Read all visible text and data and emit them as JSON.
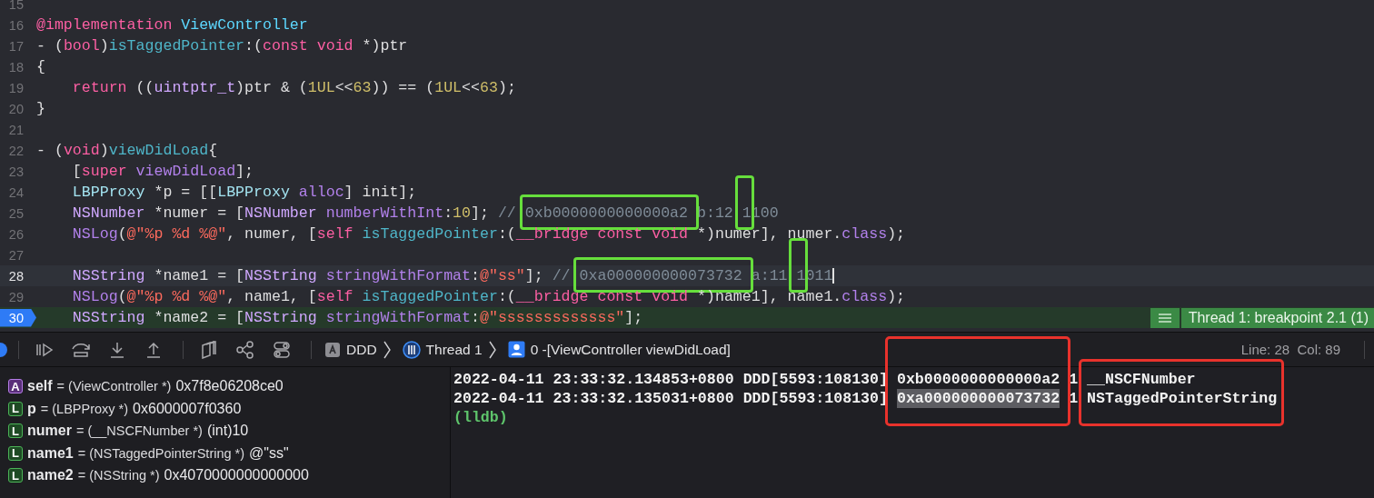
{
  "editor": {
    "lines": [
      {
        "number": "15",
        "current": false,
        "stopped": false
      },
      {
        "number": "16",
        "current": false,
        "stopped": false,
        "tokens": [
          {
            "kind": "keyword",
            "text": "@implementation"
          },
          {
            "kind": "project-class",
            "text": " ViewController"
          }
        ]
      },
      {
        "number": "17",
        "current": false,
        "stopped": false,
        "tokens": [
          {
            "kind": "plain",
            "text": "- ("
          },
          {
            "kind": "keyword",
            "text": "bool"
          },
          {
            "kind": "plain",
            "text": ")"
          },
          {
            "kind": "project-method",
            "text": "isTaggedPointer"
          },
          {
            "kind": "plain",
            "text": ":("
          },
          {
            "kind": "keyword",
            "text": "const"
          },
          {
            "kind": "keyword",
            "text": " void"
          },
          {
            "kind": "plain",
            "text": " *)ptr"
          }
        ]
      },
      {
        "number": "18",
        "current": false,
        "stopped": false,
        "tokens": [
          {
            "kind": "plain",
            "text": "{"
          }
        ]
      },
      {
        "number": "19",
        "current": false,
        "stopped": false,
        "tokens": [
          {
            "kind": "keyword",
            "text": "    return"
          },
          {
            "kind": "plain",
            "text": " (("
          },
          {
            "kind": "system-type",
            "text": "uintptr_t"
          },
          {
            "kind": "plain",
            "text": ")ptr & ("
          },
          {
            "kind": "number",
            "text": "1UL"
          },
          {
            "kind": "plain",
            "text": "<<"
          },
          {
            "kind": "number",
            "text": "63"
          },
          {
            "kind": "plain",
            "text": ")) == ("
          },
          {
            "kind": "number",
            "text": "1UL"
          },
          {
            "kind": "plain",
            "text": "<<"
          },
          {
            "kind": "number",
            "text": "63"
          },
          {
            "kind": "plain",
            "text": ");"
          }
        ]
      },
      {
        "number": "20",
        "current": false,
        "stopped": false,
        "tokens": [
          {
            "kind": "plain",
            "text": "}"
          }
        ]
      },
      {
        "number": "21",
        "current": false,
        "stopped": false
      },
      {
        "number": "22",
        "current": false,
        "stopped": false,
        "tokens": [
          {
            "kind": "plain",
            "text": "- ("
          },
          {
            "kind": "keyword",
            "text": "void"
          },
          {
            "kind": "plain",
            "text": ")"
          },
          {
            "kind": "project-method",
            "text": "viewDidLoad"
          },
          {
            "kind": "plain",
            "text": "{"
          }
        ]
      },
      {
        "number": "23",
        "current": false,
        "stopped": false,
        "tokens": [
          {
            "kind": "plain",
            "text": "    ["
          },
          {
            "kind": "keyword",
            "text": "super"
          },
          {
            "kind": "system-method",
            "text": " viewDidLoad"
          },
          {
            "kind": "plain",
            "text": "];"
          }
        ]
      },
      {
        "number": "24",
        "current": false,
        "stopped": false,
        "tokens": [
          {
            "kind": "project-type",
            "text": "    LBPProxy"
          },
          {
            "kind": "plain",
            "text": " *p = [["
          },
          {
            "kind": "project-type",
            "text": "LBPProxy"
          },
          {
            "kind": "system-method",
            "text": " alloc"
          },
          {
            "kind": "plain",
            "text": "] init];"
          }
        ]
      },
      {
        "number": "25",
        "current": false,
        "stopped": false,
        "tokens": [
          {
            "kind": "system-type",
            "text": "    NSNumber"
          },
          {
            "kind": "plain",
            "text": " *numer = ["
          },
          {
            "kind": "system-type",
            "text": "NSNumber"
          },
          {
            "kind": "system-method",
            "text": " numberWithInt"
          },
          {
            "kind": "plain",
            "text": ":"
          },
          {
            "kind": "number",
            "text": "10"
          },
          {
            "kind": "plain",
            "text": "]; "
          },
          {
            "kind": "comment",
            "text": "// "
          },
          {
            "kind": "comment",
            "text": "0xb0000000000000a2",
            "framed": true
          },
          {
            "kind": "comment",
            "text": " b:12 "
          },
          {
            "kind": "comment",
            "text": "1",
            "framed": true
          },
          {
            "kind": "comment",
            "text": "100"
          }
        ]
      },
      {
        "number": "26",
        "current": false,
        "stopped": false,
        "tokens": [
          {
            "kind": "system-method",
            "text": "    NSLog"
          },
          {
            "kind": "plain",
            "text": "("
          },
          {
            "kind": "string",
            "text": "@\"%p %d %@\""
          },
          {
            "kind": "plain",
            "text": ", numer, ["
          },
          {
            "kind": "keyword",
            "text": "self"
          },
          {
            "kind": "project-method",
            "text": " isTaggedPointer"
          },
          {
            "kind": "plain",
            "text": ":("
          },
          {
            "kind": "keyword",
            "text": "__bridge"
          },
          {
            "kind": "keyword",
            "text": " const"
          },
          {
            "kind": "keyword",
            "text": " void"
          },
          {
            "kind": "plain",
            "text": " *)numer], numer."
          },
          {
            "kind": "system-method",
            "text": "class"
          },
          {
            "kind": "plain",
            "text": ");"
          }
        ]
      },
      {
        "number": "27",
        "current": false,
        "stopped": false
      },
      {
        "number": "28",
        "current": true,
        "stopped": false,
        "tokens": [
          {
            "kind": "system-type",
            "text": "    NSString"
          },
          {
            "kind": "plain",
            "text": " *name1 = ["
          },
          {
            "kind": "system-type",
            "text": "NSString"
          },
          {
            "kind": "system-method",
            "text": " stringWithFormat"
          },
          {
            "kind": "plain",
            "text": ":"
          },
          {
            "kind": "string",
            "text": "@\"ss\""
          },
          {
            "kind": "plain",
            "text": "]; "
          },
          {
            "kind": "comment",
            "text": "// "
          },
          {
            "kind": "comment",
            "text": "0xa000000000073732",
            "framed": true
          },
          {
            "kind": "comment",
            "text": " a:11 "
          },
          {
            "kind": "comment",
            "text": "1",
            "framed": true
          },
          {
            "kind": "comment",
            "text": "011"
          }
        ]
      },
      {
        "number": "29",
        "current": false,
        "stopped": false,
        "tokens": [
          {
            "kind": "system-method",
            "text": "    NSLog"
          },
          {
            "kind": "plain",
            "text": "("
          },
          {
            "kind": "string",
            "text": "@\"%p %d %@\""
          },
          {
            "kind": "plain",
            "text": ", name1, ["
          },
          {
            "kind": "keyword",
            "text": "self"
          },
          {
            "kind": "project-method",
            "text": " isTaggedPointer"
          },
          {
            "kind": "plain",
            "text": ":("
          },
          {
            "kind": "keyword",
            "text": "__bridge"
          },
          {
            "kind": "keyword",
            "text": " const"
          },
          {
            "kind": "keyword",
            "text": " void"
          },
          {
            "kind": "plain",
            "text": " *)name1], name1."
          },
          {
            "kind": "system-method",
            "text": "class"
          },
          {
            "kind": "plain",
            "text": ");"
          }
        ]
      },
      {
        "number": "30",
        "current": false,
        "stopped": true,
        "tokens": [
          {
            "kind": "system-type",
            "text": "    NSString"
          },
          {
            "kind": "plain",
            "text": " *name2 = ["
          },
          {
            "kind": "system-type",
            "text": "NSString"
          },
          {
            "kind": "system-method",
            "text": " stringWithFormat"
          },
          {
            "kind": "plain",
            "text": ":"
          },
          {
            "kind": "string",
            "text": "@\"sssssssssssss\""
          },
          {
            "kind": "plain",
            "text": "];"
          }
        ],
        "annotation": "Thread 1: breakpoint 2.1 (1)"
      }
    ]
  },
  "debug_bar": {
    "breadcrumbs": [
      {
        "kind": "app",
        "text": "DDD"
      },
      {
        "kind": "thread",
        "text": "Thread 1"
      },
      {
        "kind": "frame",
        "text": "0 -[ViewController viewDidLoad]"
      }
    ],
    "position": "Line: 28  Col: 89"
  },
  "variables": [
    {
      "kind": "argument",
      "badge": "A",
      "name": "self",
      "type": "= (ViewController *)",
      "value": "0x7f8e06208ce0"
    },
    {
      "kind": "local",
      "badge": "L",
      "name": "p",
      "type": "= (LBPProxy *)",
      "value": "0x6000007f0360"
    },
    {
      "kind": "local",
      "badge": "L",
      "name": "numer",
      "type": "= (__NSCFNumber *)",
      "value": "(int)10"
    },
    {
      "kind": "local",
      "badge": "L",
      "name": "name1",
      "type": "= (NSTaggedPointerString *)",
      "value": "@\"ss\""
    },
    {
      "kind": "local",
      "badge": "L",
      "name": "name2",
      "type": "= (NSString *)",
      "value": "0x4070000000000000"
    }
  ],
  "console": {
    "address_framed": true,
    "class_framed": true,
    "lines": [
      {
        "prefix": "2022-04-11 23:33:32.134853+0800 DDD[5593:108130]",
        "address": "0xb0000000000000a2",
        "selected": false,
        "count": "1",
        "class_name": "__NSCFNumber"
      },
      {
        "prefix": "2022-04-11 23:33:32.135031+0800 DDD[5593:108130]",
        "address": "0xa000000000073732",
        "selected": true,
        "count": "1",
        "class_name": "NSTaggedPointerString"
      }
    ],
    "prompt": "(lldb)"
  }
}
